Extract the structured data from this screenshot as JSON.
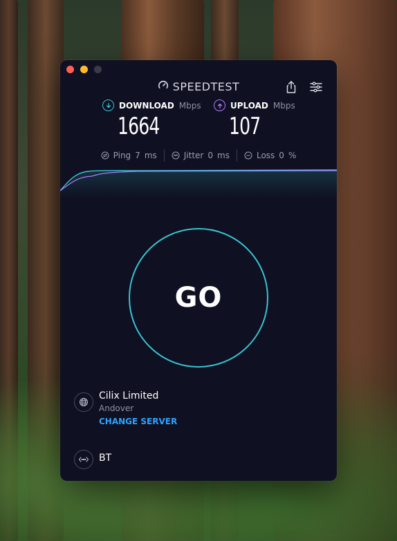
{
  "app": {
    "brand": "SPEEDTEST"
  },
  "metrics": {
    "download": {
      "label": "DOWNLOAD",
      "unit": "Mbps",
      "value": "1664",
      "accent": "#36c7d3"
    },
    "upload": {
      "label": "UPLOAD",
      "unit": "Mbps",
      "value": "107",
      "accent": "#b27bff"
    }
  },
  "stats": {
    "ping": {
      "label": "Ping",
      "value": "7",
      "unit": "ms"
    },
    "jitter": {
      "label": "Jitter",
      "value": "0",
      "unit": "ms"
    },
    "loss": {
      "label": "Loss",
      "value": "0",
      "unit": "%"
    }
  },
  "go": {
    "label": "GO"
  },
  "server": {
    "name": "Cilix Limited",
    "location": "Andover",
    "change_label": "CHANGE SERVER"
  },
  "isp": {
    "name": "BT"
  },
  "icons": {
    "brand": "speedometer-icon",
    "share": "share-icon",
    "settings": "sliders-icon",
    "server": "globe-icon",
    "isp": "network-icon"
  },
  "colors": {
    "window_bg": "#0f1021",
    "accent_cyan": "#36c7d3",
    "accent_purple": "#b27bff",
    "link_blue": "#2ea3ff"
  }
}
